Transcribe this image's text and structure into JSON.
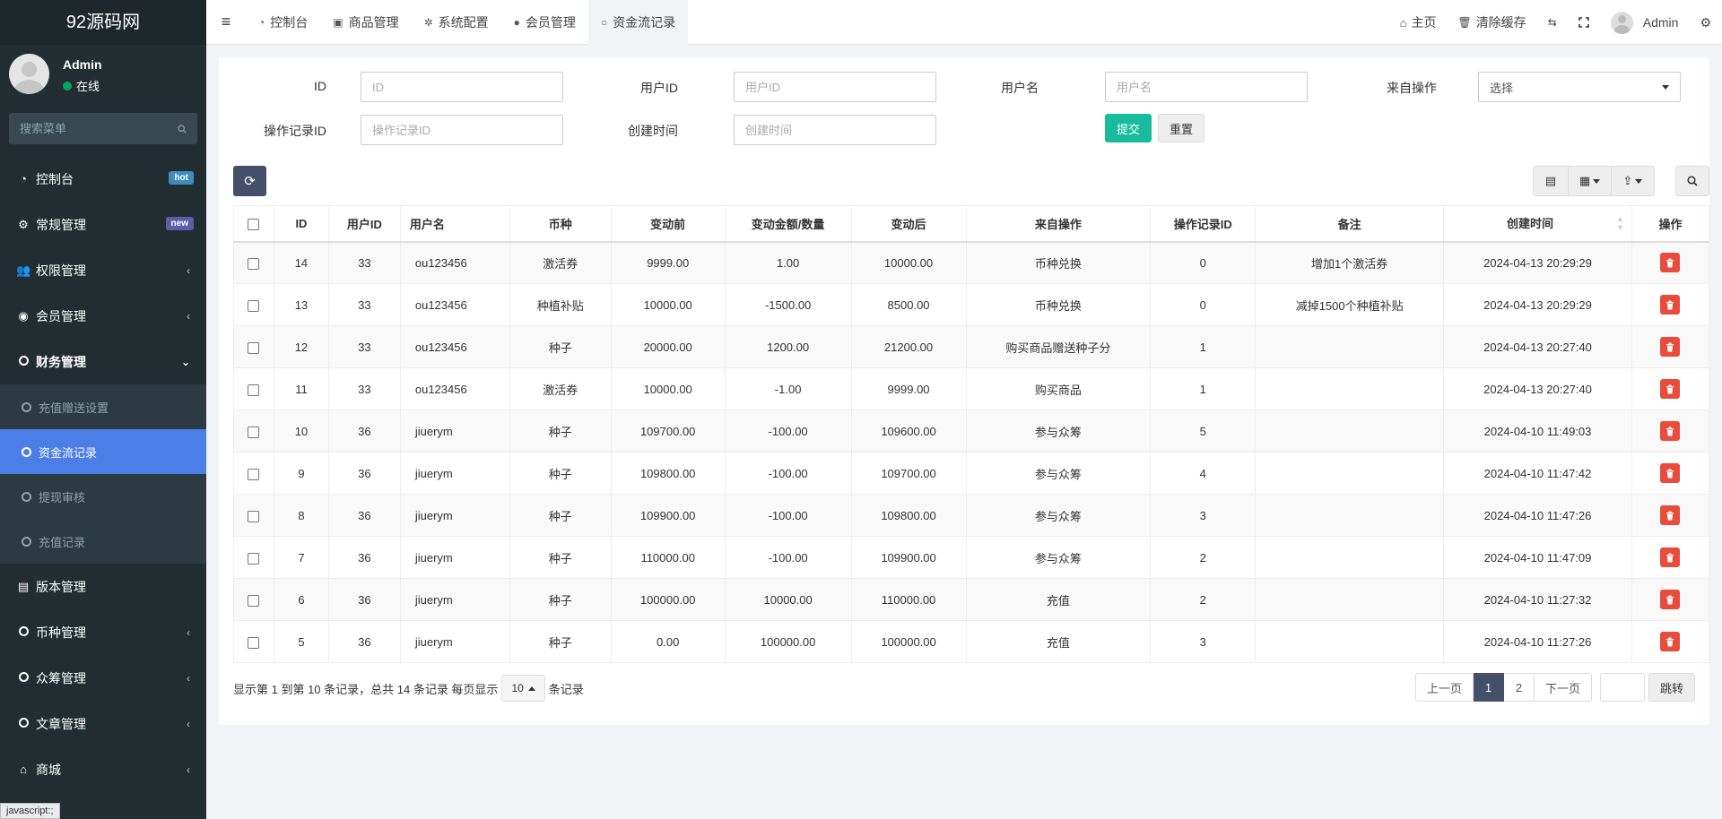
{
  "app": {
    "logo": "92源码网"
  },
  "user": {
    "name": "Admin",
    "status": "在线"
  },
  "sidebar": {
    "search_placeholder": "搜索菜单",
    "items": [
      {
        "label": "控制台",
        "icon": "dashboard-icon",
        "badge": "hot"
      },
      {
        "label": "常规管理",
        "icon": "cogs-icon",
        "badge": "new"
      },
      {
        "label": "权限管理",
        "icon": "group-icon"
      },
      {
        "label": "会员管理",
        "icon": "user-circle-icon"
      },
      {
        "label": "财务管理",
        "icon": "circle-icon",
        "expanded": true
      },
      {
        "label": "版本管理",
        "icon": "file-icon"
      },
      {
        "label": "币种管理",
        "icon": "circle-icon"
      },
      {
        "label": "众筹管理",
        "icon": "circle-icon"
      },
      {
        "label": "文章管理",
        "icon": "circle-icon"
      },
      {
        "label": "商城",
        "icon": "home-icon"
      }
    ],
    "finance_sub": [
      {
        "label": "充值赠送设置"
      },
      {
        "label": "资金流记录",
        "active": true
      },
      {
        "label": "提现审核"
      },
      {
        "label": "充值记录"
      }
    ]
  },
  "statusbar": {
    "text": "javascript:;"
  },
  "topbar": {
    "tabs": [
      {
        "label": "控制台",
        "icon": "dashboard-icon"
      },
      {
        "label": "商品管理",
        "icon": "shopping-bag-icon"
      },
      {
        "label": "系统配置",
        "icon": "gear-icon"
      },
      {
        "label": "会员管理",
        "icon": "user-icon"
      },
      {
        "label": "资金流记录",
        "icon": "circle-icon",
        "active": true
      }
    ],
    "home": "主页",
    "clear_cache": "清除缓存",
    "admin": "Admin"
  },
  "filters": {
    "id": {
      "label": "ID",
      "placeholder": "ID"
    },
    "user_id": {
      "label": "用户ID",
      "placeholder": "用户ID"
    },
    "username": {
      "label": "用户名",
      "placeholder": "用户名"
    },
    "from_op": {
      "label": "来自操作",
      "value": "选择"
    },
    "op_record_id": {
      "label": "操作记录ID",
      "placeholder": "操作记录ID"
    },
    "created": {
      "label": "创建时间",
      "placeholder": "创建时间"
    },
    "submit": "提交",
    "reset": "重置"
  },
  "table": {
    "columns": [
      "ID",
      "用户ID",
      "用户名",
      "币种",
      "变动前",
      "变动金额/数量",
      "变动后",
      "来自操作",
      "操作记录ID",
      "备注",
      "创建时间",
      "操作"
    ],
    "rows": [
      [
        "14",
        "33",
        "ou123456",
        "激活券",
        "9999.00",
        "1.00",
        "10000.00",
        "币种兑换",
        "0",
        "增加1个激活券",
        "2024-04-13 20:29:29"
      ],
      [
        "13",
        "33",
        "ou123456",
        "种植补贴",
        "10000.00",
        "-1500.00",
        "8500.00",
        "币种兑换",
        "0",
        "减掉1500个种植补贴",
        "2024-04-13 20:29:29"
      ],
      [
        "12",
        "33",
        "ou123456",
        "种子",
        "20000.00",
        "1200.00",
        "21200.00",
        "购买商品赠送种子分",
        "1",
        "",
        "2024-04-13 20:27:40"
      ],
      [
        "11",
        "33",
        "ou123456",
        "激活券",
        "10000.00",
        "-1.00",
        "9999.00",
        "购买商品",
        "1",
        "",
        "2024-04-13 20:27:40"
      ],
      [
        "10",
        "36",
        "jiuerym",
        "种子",
        "109700.00",
        "-100.00",
        "109600.00",
        "参与众筹",
        "5",
        "",
        "2024-04-10 11:49:03"
      ],
      [
        "9",
        "36",
        "jiuerym",
        "种子",
        "109800.00",
        "-100.00",
        "109700.00",
        "参与众筹",
        "4",
        "",
        "2024-04-10 11:47:42"
      ],
      [
        "8",
        "36",
        "jiuerym",
        "种子",
        "109900.00",
        "-100.00",
        "109800.00",
        "参与众筹",
        "3",
        "",
        "2024-04-10 11:47:26"
      ],
      [
        "7",
        "36",
        "jiuerym",
        "种子",
        "110000.00",
        "-100.00",
        "109900.00",
        "参与众筹",
        "2",
        "",
        "2024-04-10 11:47:09"
      ],
      [
        "6",
        "36",
        "jiuerym",
        "种子",
        "100000.00",
        "10000.00",
        "110000.00",
        "充值",
        "2",
        "",
        "2024-04-10 11:27:32"
      ],
      [
        "5",
        "36",
        "jiuerym",
        "种子",
        "0.00",
        "100000.00",
        "100000.00",
        "充值",
        "3",
        "",
        "2024-04-10 11:27:26"
      ]
    ]
  },
  "pagination": {
    "info_prefix": "显示第 1 到第 10 条记录，总共 14 条记录 每页显示",
    "page_size": "10",
    "info_suffix": "条记录",
    "prev": "上一页",
    "pages": [
      "1",
      "2"
    ],
    "next": "下一页",
    "jump": "跳转"
  },
  "colors": {
    "accent": "#4c7ee7",
    "submit": "#18bc9c",
    "danger": "#e74c3c",
    "sidebar": "#222d32",
    "primary_dark": "#444f6a"
  }
}
